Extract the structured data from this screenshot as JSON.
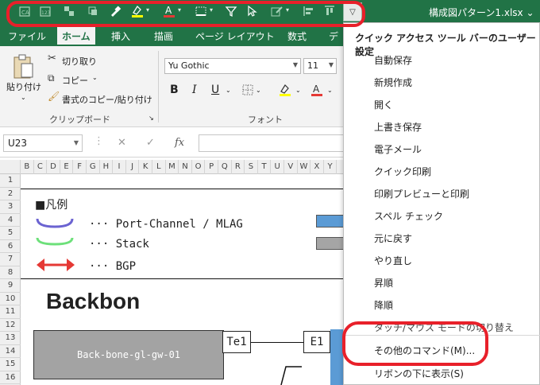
{
  "titlebar": {
    "filename": "構成図パターン1.xlsx",
    "qat_icons": [
      "sort-asc-icon",
      "number-format-icon",
      "group-icon",
      "ungroup-icon",
      "brush-icon",
      "highlight-color-icon",
      "font-color-icon",
      "border-icon",
      "filter-icon",
      "select-pointer-icon",
      "edit-icon",
      "align-left-icon",
      "align-top-icon"
    ],
    "customize_icon": "chevron-down-icon"
  },
  "ribbon": {
    "tabs": [
      "ファイル",
      "ホーム",
      "挿入",
      "描画",
      "ページ レイアウト",
      "数式",
      "デ"
    ],
    "active_tab": "ホーム",
    "clipboard": {
      "paste_label": "貼り付け",
      "cut_label": "切り取り",
      "copy_label": "コピー",
      "format_painter_label": "書式のコピー/貼り付け",
      "group_label": "クリップボード"
    },
    "font": {
      "font_name": "Yu Gothic",
      "font_size": "11",
      "bold": "B",
      "italic": "I",
      "underline": "U",
      "group_label": "フォント"
    }
  },
  "formula_bar": {
    "name_box": "U23",
    "fx_label": "fx"
  },
  "grid": {
    "columns": [
      "B",
      "C",
      "D",
      "E",
      "F",
      "G",
      "H",
      "I",
      "J",
      "K",
      "L",
      "M",
      "N",
      "O",
      "P",
      "Q",
      "R",
      "S",
      "T",
      "U",
      "V",
      "W",
      "X",
      "Y"
    ],
    "rows": [
      "1",
      "2",
      "3",
      "4",
      "5",
      "6",
      "7",
      "8",
      "9",
      "10",
      "11",
      "12",
      "13",
      "14",
      "15",
      "16"
    ]
  },
  "sheet": {
    "legend_title": "■凡例",
    "legend_items": [
      {
        "label": "··· Port-Channel / MLAG",
        "color": "#6b63d1"
      },
      {
        "label": "··· Stack",
        "color": "#6de07a"
      },
      {
        "label": "··· BGP",
        "color": "#e53935"
      }
    ],
    "heading": "Backbon",
    "node_label": "Back-bone-gl-gw-01",
    "port1": "Te1",
    "port2": "E1"
  },
  "menu": {
    "header": "クイック アクセス ツール バーのユーザー設定",
    "items": [
      "自動保存",
      "新規作成",
      "開く",
      "上書き保存",
      "電子メール",
      "クイック印刷",
      "印刷プレビューと印刷",
      "スペル チェック",
      "元に戻す",
      "やり直し",
      "昇順",
      "降順"
    ],
    "partial_item": "タッチ/マウス モードの切り替え",
    "more_commands": "その他のコマンド(M)...",
    "show_below": "リボンの下に表示(S)"
  },
  "colors": {
    "excel_green": "#217346",
    "annotation_red": "#e8202a"
  }
}
